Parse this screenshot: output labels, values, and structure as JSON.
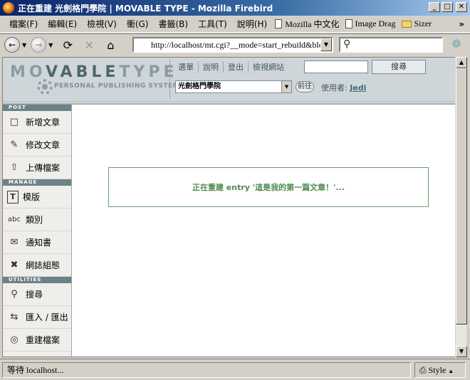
{
  "window": {
    "title": "正在重建 光劍格門學院 | MOVABLE TYPE - Mozilla Firebird"
  },
  "menubar": {
    "items": [
      "檔案(F)",
      "編輯(E)",
      "檢視(V)",
      "衝(G)",
      "書籤(B)",
      "工具(T)",
      "說明(H)"
    ],
    "bookmarks": [
      {
        "label": "Mozilla 中文化",
        "icon": "page-icon"
      },
      {
        "label": "Image Drag",
        "icon": "page-icon"
      },
      {
        "label": "Sizer",
        "icon": "folder-icon"
      }
    ],
    "overflow": "»"
  },
  "navbar": {
    "url": "http://localhost/mt.cgi?__mode=start_rebuild&blog",
    "search_placeholder": ""
  },
  "mt": {
    "logo_main": "MOVABLETYPE",
    "logo_sub": "PERSONAL PUBLISHING SYSTEM",
    "topnav": [
      "選單",
      "說明",
      "登出",
      "檢視網站"
    ],
    "search_button": "搜尋",
    "blog_select": "光劍格門學院",
    "go_button": "前往",
    "user_label": "使用者:",
    "user_name": "Jedi"
  },
  "sidebar": {
    "sections": [
      {
        "title": "POST",
        "items": [
          {
            "label": "新增文章",
            "icon": "new-entry-icon"
          },
          {
            "label": "修改文章",
            "icon": "edit-entry-icon"
          },
          {
            "label": "上傳檔案",
            "icon": "upload-icon"
          }
        ]
      },
      {
        "title": "MANAGE",
        "items": [
          {
            "label": "模版",
            "icon": "template-icon"
          },
          {
            "label": "類別",
            "icon": "category-icon"
          },
          {
            "label": "通知書",
            "icon": "notification-icon"
          },
          {
            "label": "網誌組態",
            "icon": "config-icon"
          }
        ]
      },
      {
        "title": "UTILITIES",
        "items": [
          {
            "label": "搜尋",
            "icon": "search-icon"
          },
          {
            "label": "匯入 / 匯出",
            "icon": "import-export-icon"
          },
          {
            "label": "重建檔案",
            "icon": "rebuild-icon"
          }
        ]
      }
    ]
  },
  "message": "正在重建 entry '這是我的第一篇文章！'...",
  "status": {
    "text": "等待 localhost...",
    "style_label": "Style"
  }
}
